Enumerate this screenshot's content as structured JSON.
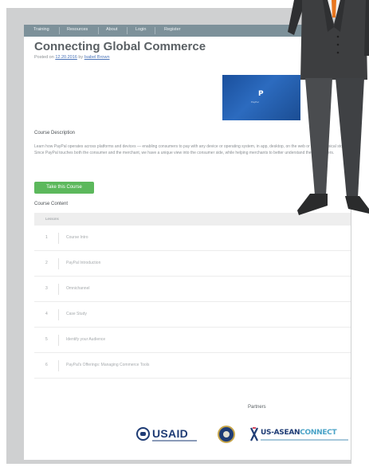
{
  "nav": {
    "items": [
      "Training",
      "Resources",
      "About",
      "Login",
      "Register"
    ]
  },
  "post": {
    "title": "Connecting Global Commerce",
    "posted_prefix": "Posted on",
    "date": "12.20.2016",
    "by": "by",
    "author": "Isabel Brown"
  },
  "thumbnail": {
    "logo_text": "P",
    "caption": "PayPal"
  },
  "course": {
    "description_heading": "Course Description",
    "description": "Learn how PayPal operates across platforms and devices — enabling consumers to pay with any device or operating system, in app, desktop, on the web or in the physical store. Since PayPal touches both the consumer and the merchant, we have a unique view into the consumer side, while helping merchants to better understand their customers.",
    "take_button": "Take this Course",
    "content_heading": "Course Content",
    "table_header": "Lessons",
    "lessons": [
      {
        "num": "1",
        "title": "Course Intro"
      },
      {
        "num": "2",
        "title": "PayPal Introduction"
      },
      {
        "num": "3",
        "title": "Omnichannel"
      },
      {
        "num": "4",
        "title": "Case Study"
      },
      {
        "num": "5",
        "title": "Identify your Audience"
      },
      {
        "num": "6",
        "title": "PayPal's Offerings: Managing Commerce Tools"
      }
    ]
  },
  "partners": {
    "heading": "Partners",
    "logos": {
      "usaid": "USAID",
      "asean_us": "US-ASEAN",
      "asean_connect": "CONNECT"
    }
  },
  "colors": {
    "nav": "#7d919a",
    "button": "#5cb85c",
    "link": "#4b74b8",
    "suit": "#3d3e40",
    "tie": "#e8761f"
  }
}
